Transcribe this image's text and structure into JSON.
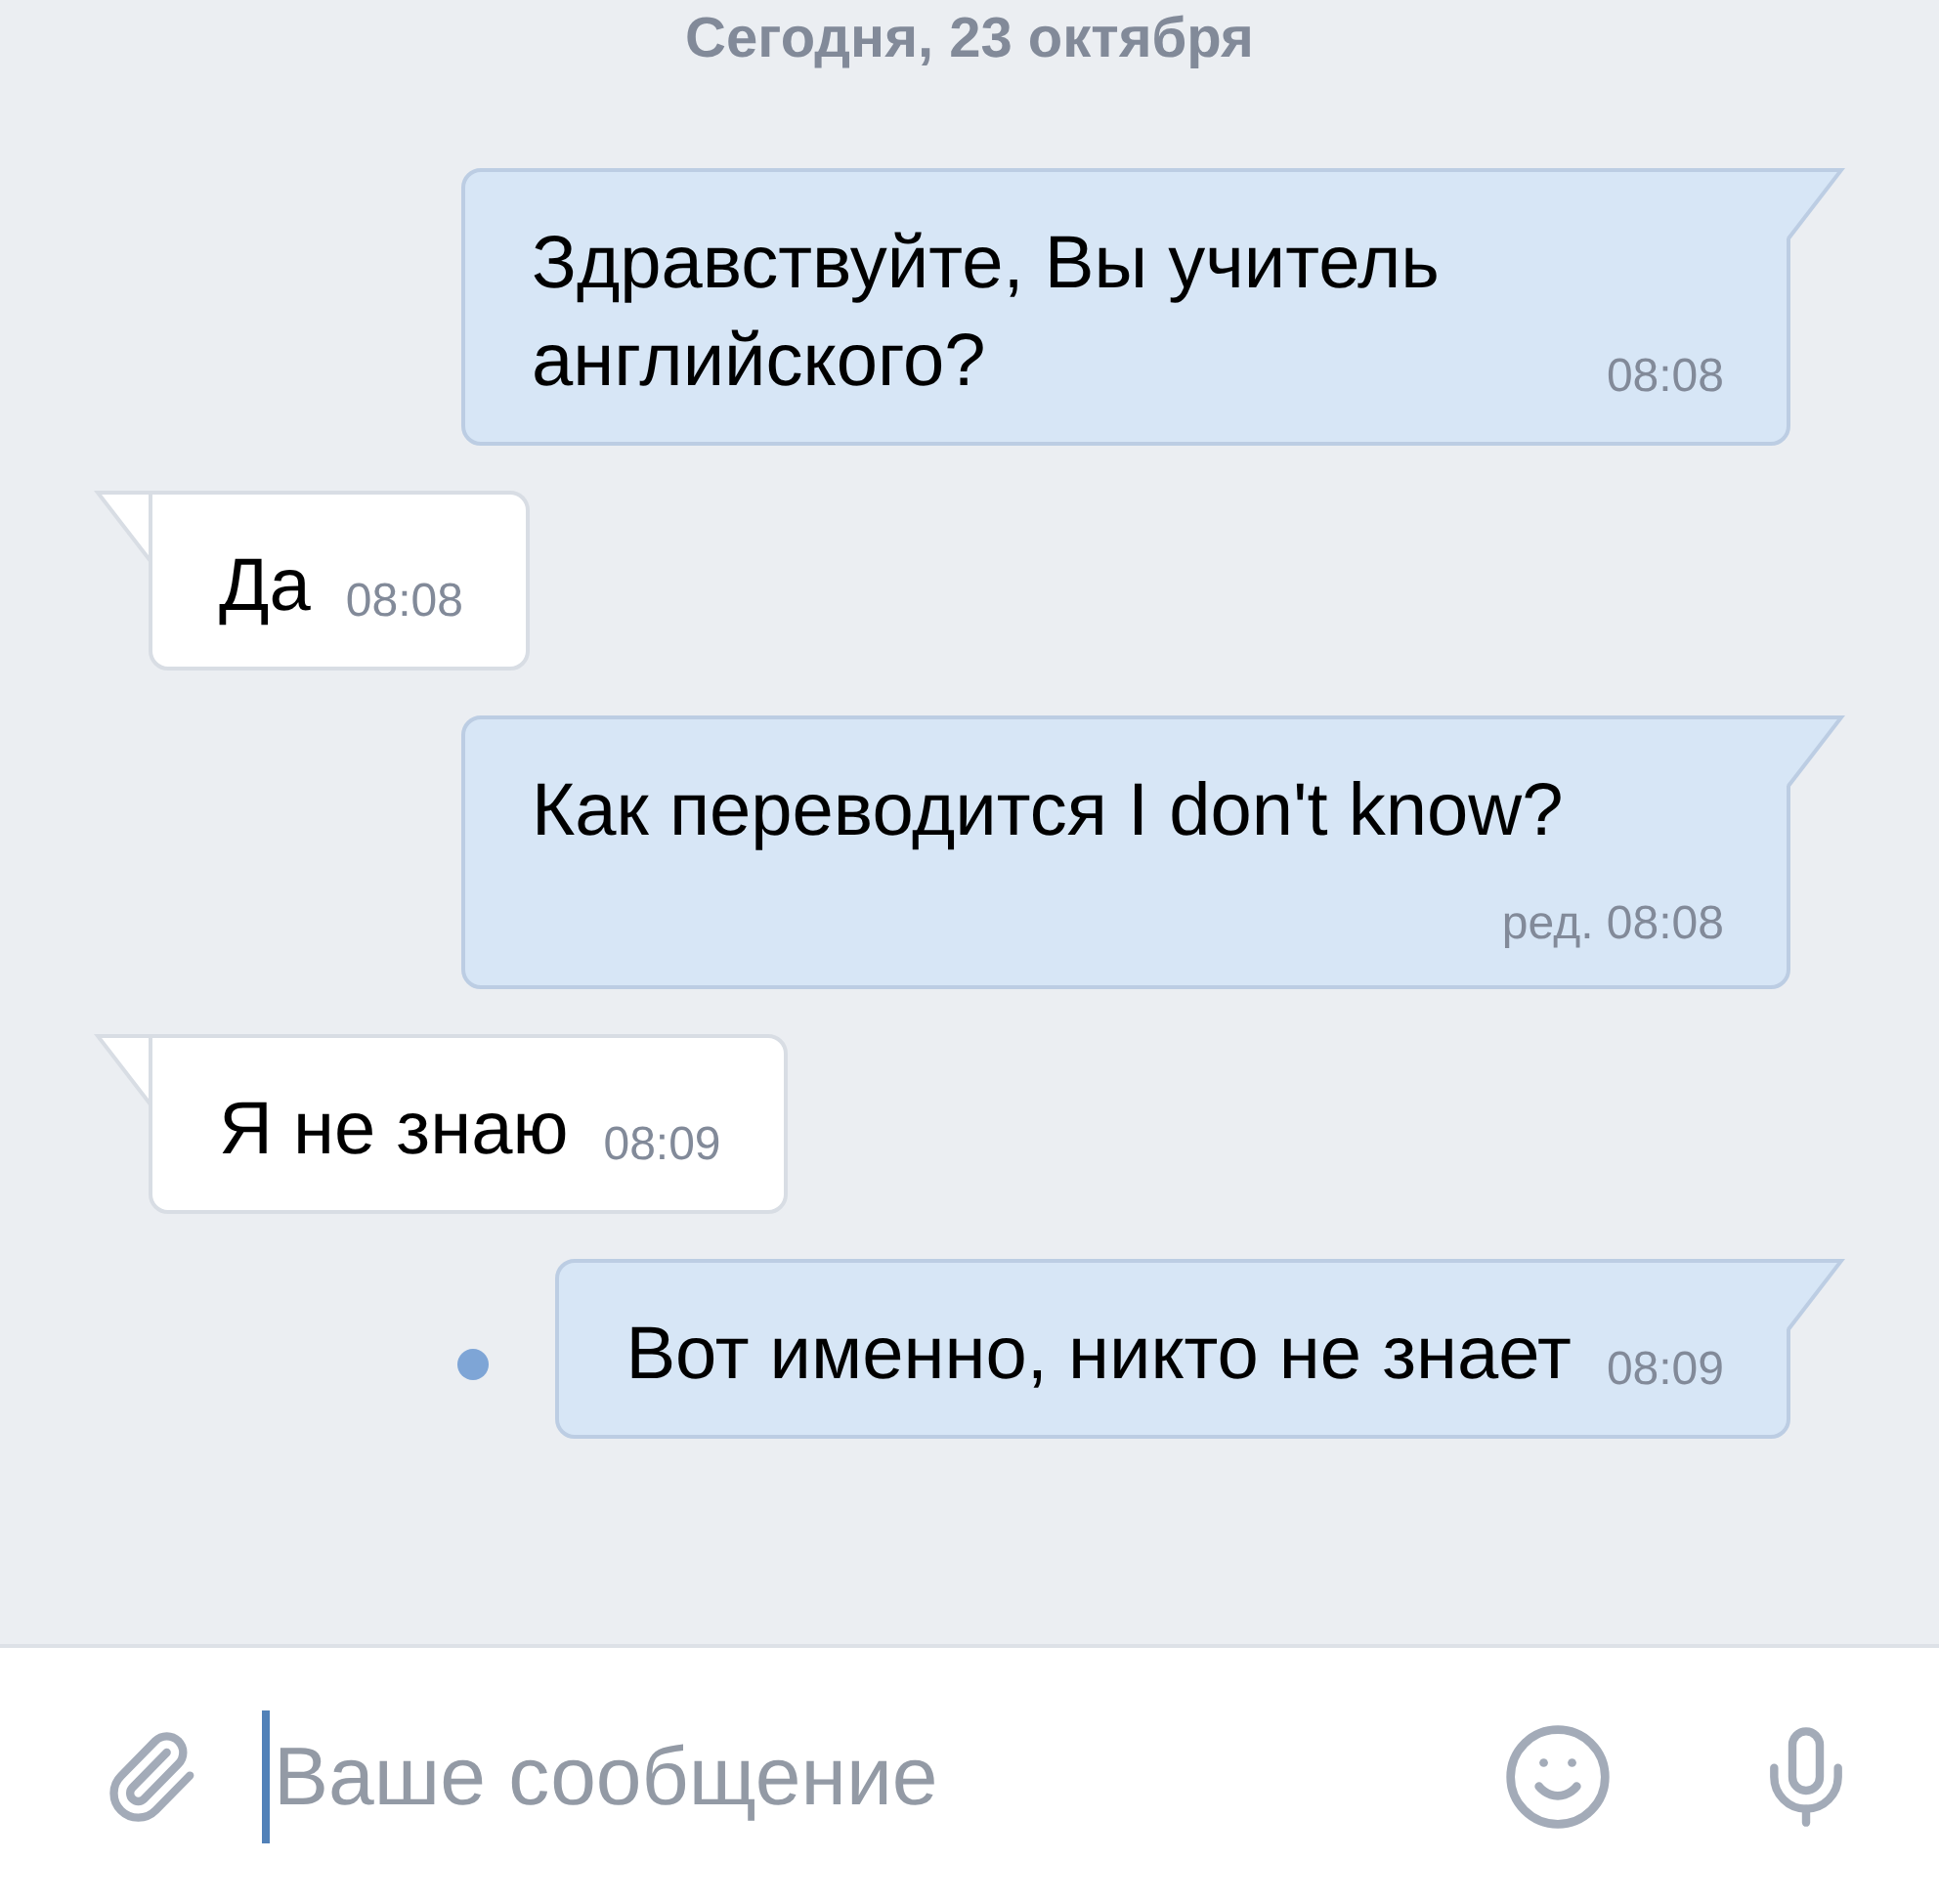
{
  "date_header": "Сегодня, 23 октября",
  "messages": [
    {
      "kind": "outgoing",
      "text": "Здравствуйте, Вы учитель английского?",
      "time": "08:08",
      "unread": false
    },
    {
      "kind": "incoming",
      "text": "Да",
      "time": "08:08",
      "unread": false
    },
    {
      "kind": "outgoing",
      "text": "Как переводится I don't know?",
      "time": "ред. 08:08",
      "unread": false
    },
    {
      "kind": "incoming",
      "text": "Я не знаю",
      "time": "08:09",
      "unread": false
    },
    {
      "kind": "outgoing",
      "text": "Вот именно, никто не знает",
      "time": "08:09",
      "unread": true
    }
  ],
  "composer": {
    "placeholder": "Ваше сообщение"
  }
}
